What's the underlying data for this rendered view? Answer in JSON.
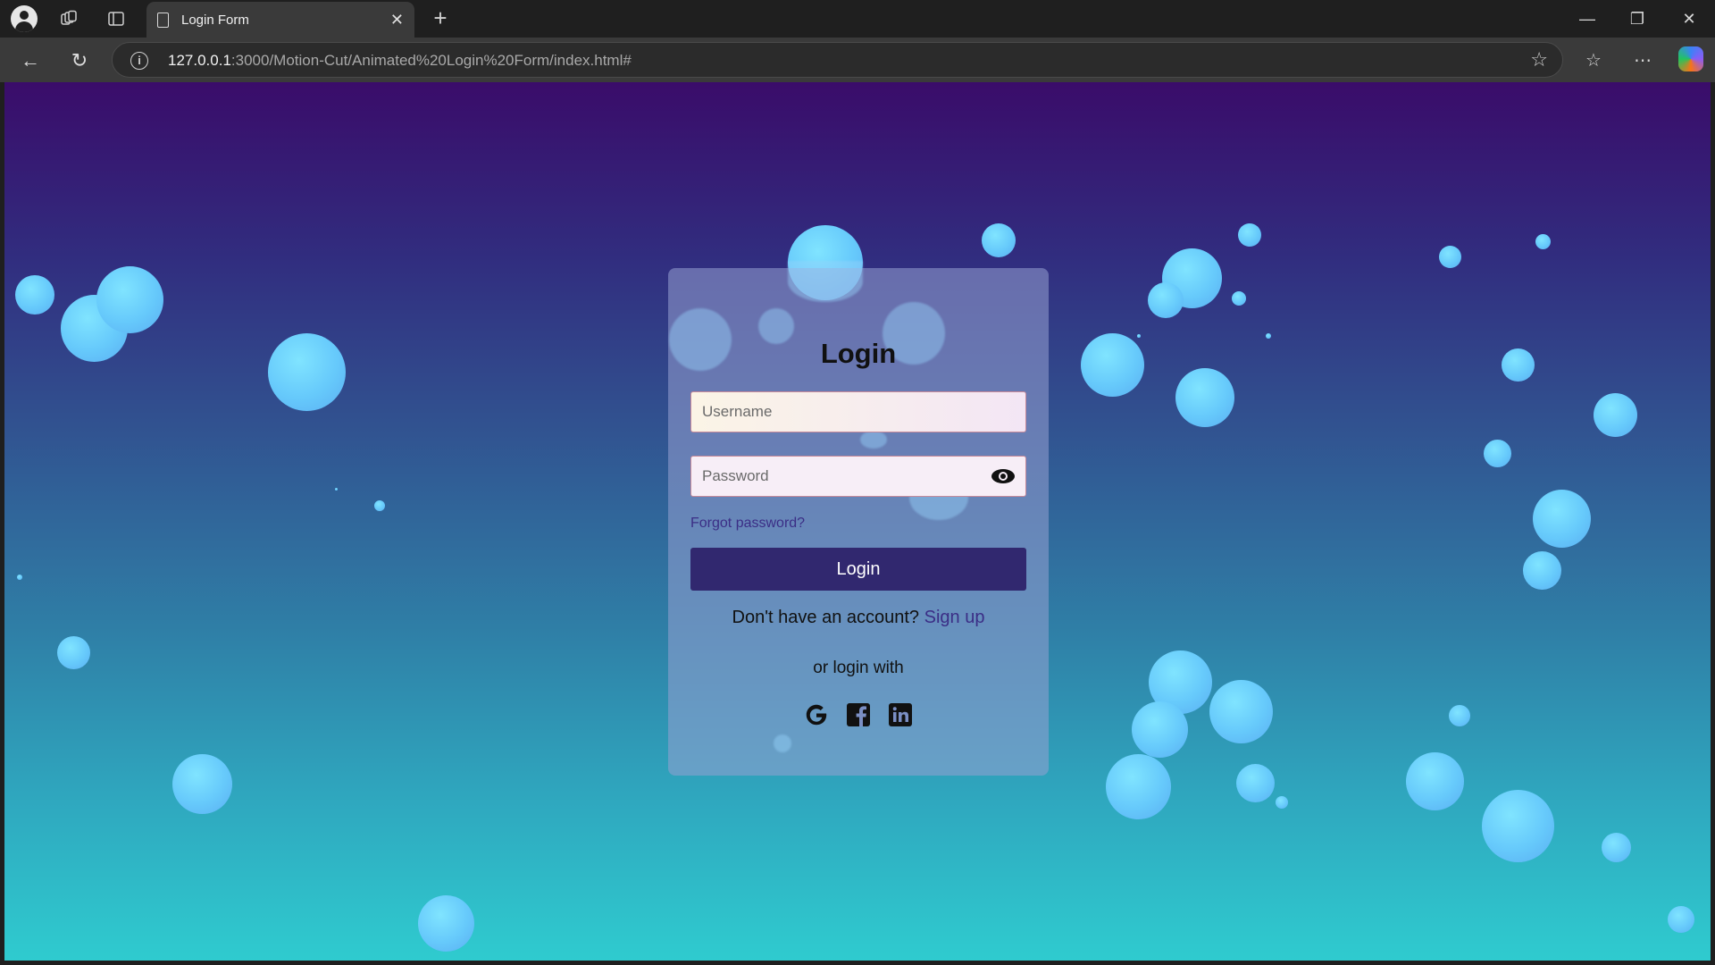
{
  "browser": {
    "tab_title": "Login Form",
    "url_host": "127.0.0.1",
    "url_rest": ":3000/Motion-Cut/Animated%20Login%20Form/index.html#",
    "icons": [
      "profile-icon",
      "workspaces-icon",
      "tab-actions-icon",
      "page-icon",
      "close-icon",
      "new-tab-icon",
      "minimize-icon",
      "restore-icon",
      "window-close-icon",
      "back-icon",
      "refresh-icon",
      "site-info-icon",
      "favorite-star-icon",
      "favorites-icon",
      "more-icon",
      "copilot-icon"
    ]
  },
  "login": {
    "title": "Login",
    "username_placeholder": "Username",
    "password_placeholder": "Password",
    "forgot": "Forgot password?",
    "button": "Login",
    "no_account": "Don't have an account?",
    "signup": "Sign up",
    "or_login_with": "or login with",
    "social": [
      "google-icon",
      "facebook-icon",
      "linkedin-icon"
    ]
  },
  "colors": {
    "gradient_top": "#3a0c6a",
    "gradient_bottom": "#2fcbcf",
    "bubble": "#66c9fb",
    "button": "#31286f",
    "link": "#3b2e86"
  }
}
